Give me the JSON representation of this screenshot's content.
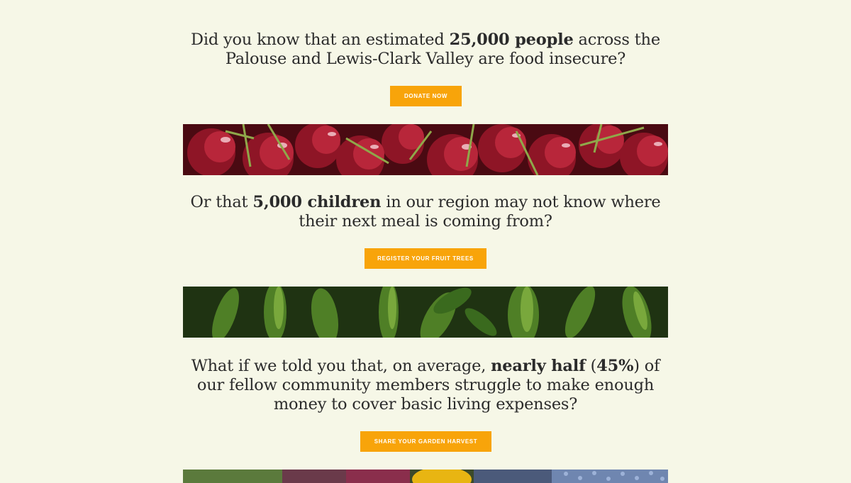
{
  "sections": [
    {
      "pre": "Did you know that an estimated ",
      "bold": "25,000 people",
      "post": " across the Palouse and Lewis-Clark Valley are food insecure?",
      "button": "DONATE NOW"
    },
    {
      "pre": "Or that ",
      "bold": "5,000 children",
      "post": " in our region may not know where their next meal is coming from?",
      "button": "REGISTER YOUR FRUIT TREES"
    },
    {
      "pre": "What if we told you that, on average, ",
      "bold": "nearly half",
      "mid": " (",
      "bold2": "45%",
      "post": ") of our fellow community members struggle to make enough money to cover basic living expenses?",
      "button": "SHARE YOUR GARDEN HARVEST"
    }
  ],
  "colors": {
    "background": "#f6f7e7",
    "button": "#f8a40a",
    "text": "#2b2b2b"
  }
}
